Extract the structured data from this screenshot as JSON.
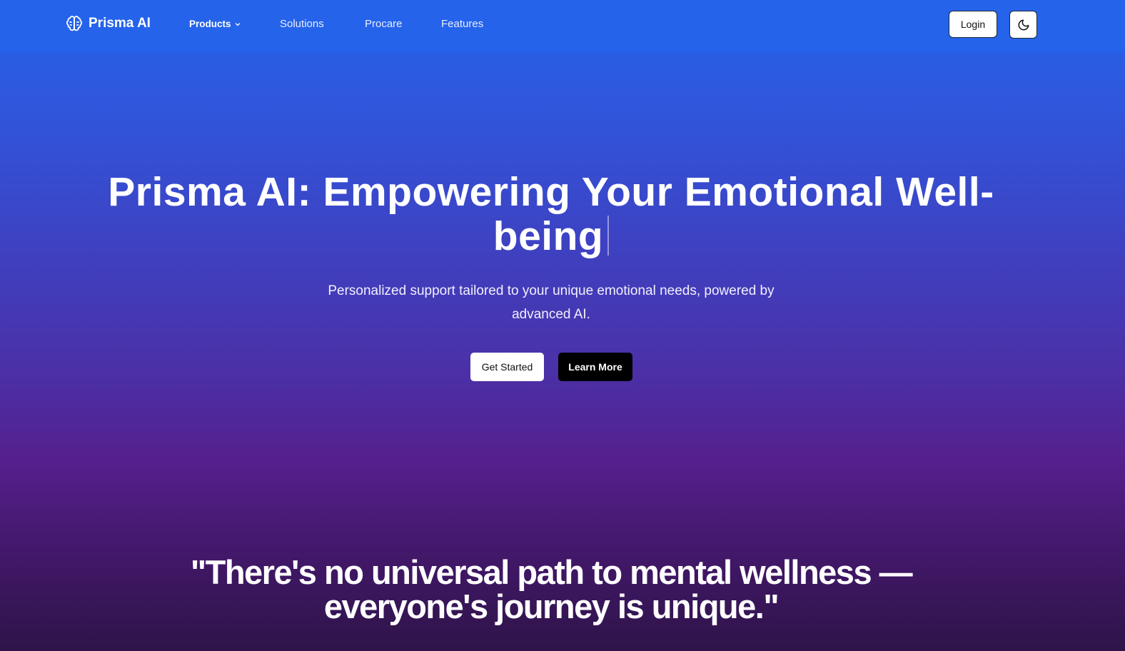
{
  "nav": {
    "brand": "Prisma AI",
    "brand_icon": "brain-icon",
    "items": [
      {
        "label": "Products",
        "has_dropdown": true
      },
      {
        "label": "Solutions"
      },
      {
        "label": "Procare"
      },
      {
        "label": "Features"
      }
    ],
    "login_label": "Login",
    "theme_toggle_icon": "moon-icon"
  },
  "hero": {
    "title": "Prisma AI: Empowering Your Emotional Well-being",
    "subtitle": "Personalized support tailored to your unique emotional needs, powered by advanced AI.",
    "primary_cta": "Get Started",
    "secondary_cta": "Learn More"
  },
  "quote": {
    "text": "\"There's no universal path to mental wellness — everyone's journey is unique.\""
  },
  "colors": {
    "navbar": "#2563eb",
    "gradient_top": "#2563eb",
    "gradient_mid": "#551f8c",
    "gradient_bottom": "#2e1448"
  }
}
